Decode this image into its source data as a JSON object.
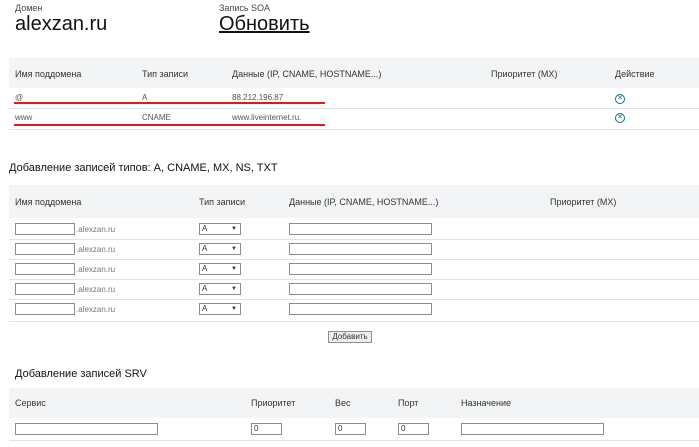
{
  "header": {
    "domain_label": "Домен",
    "domain_value": "alexzan.ru",
    "soa_label": "Запись SOA",
    "soa_link": "Обновить"
  },
  "records_table": {
    "headers": [
      "Имя поддомена",
      "Тип записи",
      "Данные (IP, CNAME, HOSTNAME...)",
      "Приоритет (MX)",
      "Действие"
    ],
    "rows": [
      {
        "name": "@",
        "type": "A",
        "data": "88.212.196.87",
        "priority": ""
      },
      {
        "name": "www",
        "type": "CNAME",
        "data": "www.liveinternet.ru.",
        "priority": ""
      }
    ]
  },
  "add_records": {
    "title": "Добавление записей типов: A, CNAME, MX, NS, TXT",
    "headers": [
      "Имя поддомена",
      "Тип записи",
      "Данные (IP, CNAME, HOSTNAME...)",
      "Приоритет (MX)"
    ],
    "suffix": ".alexzan.ru",
    "rows": [
      {
        "name": "",
        "type": "A",
        "data": ""
      },
      {
        "name": "",
        "type": "A",
        "data": ""
      },
      {
        "name": "",
        "type": "A",
        "data": ""
      },
      {
        "name": "",
        "type": "A",
        "data": ""
      },
      {
        "name": "",
        "type": "A",
        "data": ""
      }
    ],
    "add_button": "Добавить"
  },
  "srv": {
    "title": "Добавление записей SRV",
    "headers": [
      "Сервис",
      "Приоритет",
      "Вес",
      "Порт",
      "Назначение"
    ],
    "values": {
      "service": "",
      "priority": "0",
      "weight": "0",
      "port": "0",
      "target": ""
    }
  },
  "colors": {
    "accent_red": "#e0191b",
    "header_band": "#f2f4f6",
    "icon": "#0f6f86"
  }
}
